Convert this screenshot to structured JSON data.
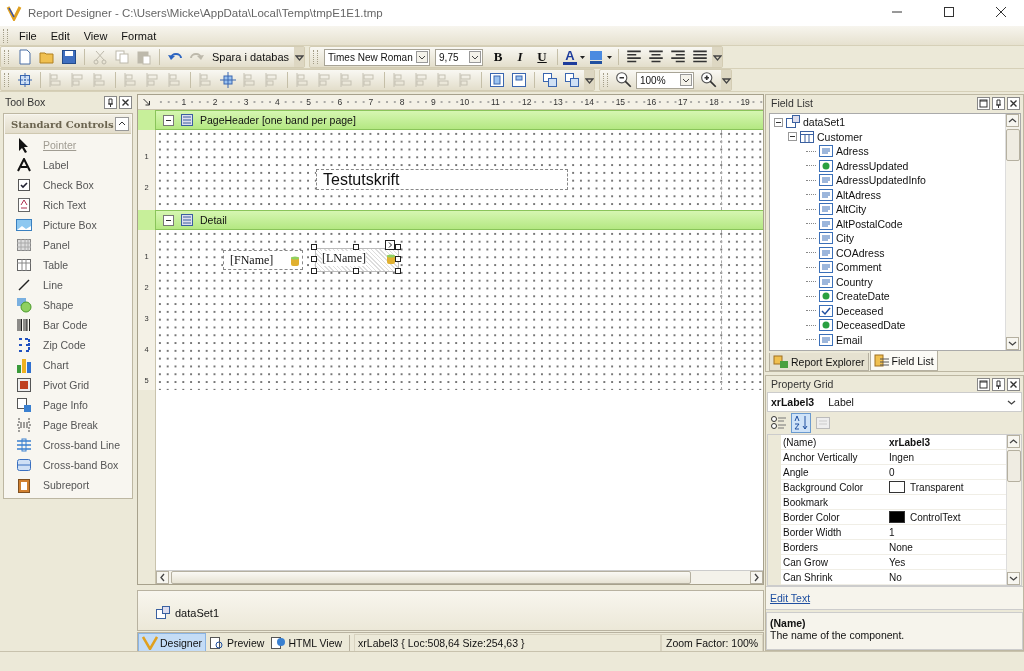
{
  "window": {
    "title": "Report Designer - C:\\Users\\Micke\\AppData\\Local\\Temp\\tmpE1E1.tmp"
  },
  "menu": [
    {
      "label": "File"
    },
    {
      "label": "Edit"
    },
    {
      "label": "View"
    },
    {
      "label": "Format"
    }
  ],
  "main_toolbar": {
    "file_buttons": [
      {
        "disabled": false
      },
      {
        "disabled": false
      },
      {
        "disabled": false
      }
    ],
    "edit_buttons": [
      {
        "disabled": true
      },
      {
        "disabled": true
      },
      {
        "disabled": true
      }
    ],
    "history_buttons": [
      {
        "disabled": false
      },
      {
        "disabled": true
      }
    ],
    "save_button": "Spara i databas"
  },
  "format_toolbar": {
    "font": "Times New Roman",
    "size": "9,75",
    "style_buttons": [
      {
        "label": "B"
      },
      {
        "label": "I"
      },
      {
        "label": "U"
      }
    ],
    "font_color_label": "A"
  },
  "layout_toolbar": {
    "groups": [
      [
        {
          "disabled": false
        }
      ],
      [
        {
          "disabled": true
        },
        {
          "disabled": true
        },
        {
          "disabled": true
        }
      ],
      [
        {
          "disabled": true
        },
        {
          "disabled": true
        },
        {
          "disabled": true
        }
      ],
      [
        {
          "disabled": true
        },
        {
          "disabled": false
        },
        {
          "disabled": true
        },
        {
          "disabled": true
        }
      ],
      [
        {
          "disabled": true
        },
        {
          "disabled": true
        },
        {
          "disabled": true
        },
        {
          "disabled": true
        }
      ],
      [
        {
          "disabled": true
        },
        {
          "disabled": true
        },
        {
          "disabled": true
        },
        {
          "disabled": true
        }
      ],
      [
        {
          "disabled": false
        },
        {
          "disabled": false
        }
      ],
      [
        {
          "disabled": false
        },
        {
          "disabled": false
        }
      ]
    ]
  },
  "zoom_toolbar": {
    "zoom": "100%"
  },
  "toolbox": {
    "title": "Tool Box",
    "group": "Standard Controls",
    "items": [
      {
        "label": "Pointer",
        "selected": true
      },
      {
        "label": "Label",
        "selected": false
      },
      {
        "label": "Check Box",
        "selected": false
      },
      {
        "label": "Rich Text",
        "selected": false
      },
      {
        "label": "Picture Box",
        "selected": false
      },
      {
        "label": "Panel",
        "selected": false
      },
      {
        "label": "Table",
        "selected": false
      },
      {
        "label": "Line",
        "selected": false
      },
      {
        "label": "Shape",
        "selected": false
      },
      {
        "label": "Bar Code",
        "selected": false
      },
      {
        "label": "Zip Code",
        "selected": false
      },
      {
        "label": "Chart",
        "selected": false
      },
      {
        "label": "Pivot Grid",
        "selected": false
      },
      {
        "label": "Page Info",
        "selected": false
      },
      {
        "label": "Page Break",
        "selected": false
      },
      {
        "label": "Cross-band Line",
        "selected": false
      },
      {
        "label": "Cross-band Box",
        "selected": false
      },
      {
        "label": "Subreport",
        "selected": false
      }
    ]
  },
  "ruler": {
    "x_ticks": [
      "1",
      "2",
      "3",
      "4",
      "5",
      "6",
      "7",
      "8",
      "9",
      "10",
      "11",
      "12",
      "13",
      "14",
      "15",
      "16",
      "17",
      "18",
      "19"
    ],
    "header_ticks": [
      "1",
      "2"
    ],
    "detail_ticks": [
      "1",
      "2",
      "3",
      "4",
      "5"
    ]
  },
  "bands": [
    {
      "title": "PageHeader [one band per page]",
      "expanded": true,
      "controls": [
        {
          "text": "Testutskrift",
          "selected": false
        }
      ]
    },
    {
      "title": "Detail",
      "expanded": true,
      "controls": [
        {
          "text": "[FName]",
          "selected": false
        },
        {
          "text": "[LName]",
          "selected": true
        }
      ]
    }
  ],
  "component_tray": [
    {
      "label": "dataSet1"
    }
  ],
  "view_tabs": [
    {
      "label": "Designer",
      "selected": true
    },
    {
      "label": "Preview",
      "selected": false
    },
    {
      "label": "HTML View",
      "selected": false
    }
  ],
  "status": {
    "selection": "xrLabel3 { Loc:508,64 Size:254,63 }",
    "zoom": "Zoom Factor: 100%"
  },
  "field_list": {
    "title": "Field List",
    "tree": [
      {
        "label": "dataSet1",
        "expanded": true,
        "children": [
          {
            "label": "Customer",
            "expanded": true,
            "children": [
              {
                "label": "Adress",
                "kind": "text"
              },
              {
                "label": "AdressUpdated",
                "kind": "date"
              },
              {
                "label": "AdressUpdatedInfo",
                "kind": "text"
              },
              {
                "label": "AltAdress",
                "kind": "text"
              },
              {
                "label": "AltCity",
                "kind": "text"
              },
              {
                "label": "AltPostalCode",
                "kind": "text"
              },
              {
                "label": "City",
                "kind": "text"
              },
              {
                "label": "COAdress",
                "kind": "text"
              },
              {
                "label": "Comment",
                "kind": "text"
              },
              {
                "label": "Country",
                "kind": "text"
              },
              {
                "label": "CreateDate",
                "kind": "date"
              },
              {
                "label": "Deceased",
                "kind": "bool"
              },
              {
                "label": "DeceasedDate",
                "kind": "date"
              },
              {
                "label": "Email",
                "kind": "text"
              }
            ]
          }
        ]
      }
    ],
    "tabs": [
      {
        "label": "Report Explorer",
        "selected": false
      },
      {
        "label": "Field List",
        "selected": true
      }
    ]
  },
  "property_grid": {
    "title": "Property Grid",
    "object_name": "xrLabel3",
    "object_type": "Label",
    "properties": [
      {
        "name": "(Name)",
        "value": "xrLabel3",
        "bold": true
      },
      {
        "name": "Anchor Vertically",
        "value": "Ingen"
      },
      {
        "name": "Angle",
        "value": "0"
      },
      {
        "name": "Background Color",
        "value": "Transparent",
        "color": "#ffffff"
      },
      {
        "name": "Bookmark"
      },
      {
        "name": "Border Color",
        "value": "ControlText",
        "color": "#000000"
      },
      {
        "name": "Border Width",
        "value": "1"
      },
      {
        "name": "Borders",
        "value": "None"
      },
      {
        "name": "Can Grow",
        "value": "Yes"
      },
      {
        "name": "Can Shrink",
        "value": "No"
      }
    ],
    "link": "Edit Text",
    "help_title": "(Name)",
    "help_text": "The name of the component."
  }
}
